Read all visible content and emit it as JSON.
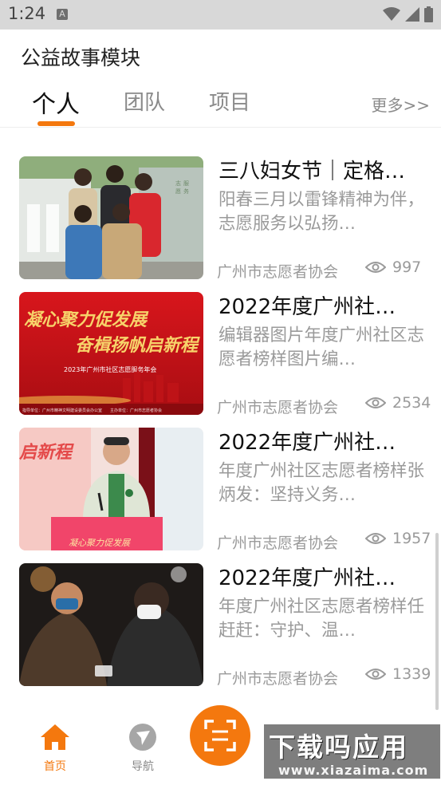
{
  "status": {
    "time": "1:24",
    "notif_letter": "A"
  },
  "module_title": "公益故事模块",
  "tabs": [
    {
      "label": "个人",
      "active": true
    },
    {
      "label": "团队",
      "active": false
    },
    {
      "label": "项目",
      "active": false
    }
  ],
  "more_label": "更多>>",
  "stories": [
    {
      "title": "三八妇女节｜定格…",
      "summary": "阳春三月以雷锋精神为伴，志愿服务以弘扬…",
      "source": "广州市志愿者协会",
      "views": "997"
    },
    {
      "title": "2022年度广州社…",
      "summary": "编辑器图片年度广州社区志愿者榜样图片编…",
      "source": "广州市志愿者协会",
      "views": "2534"
    },
    {
      "title": "2022年度广州社…",
      "summary": "年度广州社区志愿者榜样张炳发：坚持义务…",
      "source": "广州市志愿者协会",
      "views": "1957"
    },
    {
      "title": "2022年度广州社…",
      "summary": "年度广州社区志愿者榜样任赶赶：守护、温…",
      "source": "广州市志愿者协会",
      "views": "1339"
    }
  ],
  "thumb_texts": {
    "banner_line1": "凝心聚力促发展",
    "banner_line2": "奋楫扬帆启新程",
    "banner_sub": "2023年广州市社区志愿服务年会",
    "banner_footer": "指导单位：广州市精神文明建设委员会办公室　　主办单位：广州市志愿者协会",
    "stage_line": "启新程",
    "podium": "凝心聚力促发展"
  },
  "bottom_nav": [
    {
      "label": "首页",
      "icon": "home-icon",
      "active": true
    },
    {
      "label": "导航",
      "icon": "compass-icon",
      "active": false
    }
  ],
  "watermark": {
    "big": "下载吗应用",
    "small": "www.xiazaima.com"
  },
  "colors": {
    "accent": "#f4780e",
    "muted": "#9a9a9a",
    "statusbar": "#d8d8d8"
  }
}
